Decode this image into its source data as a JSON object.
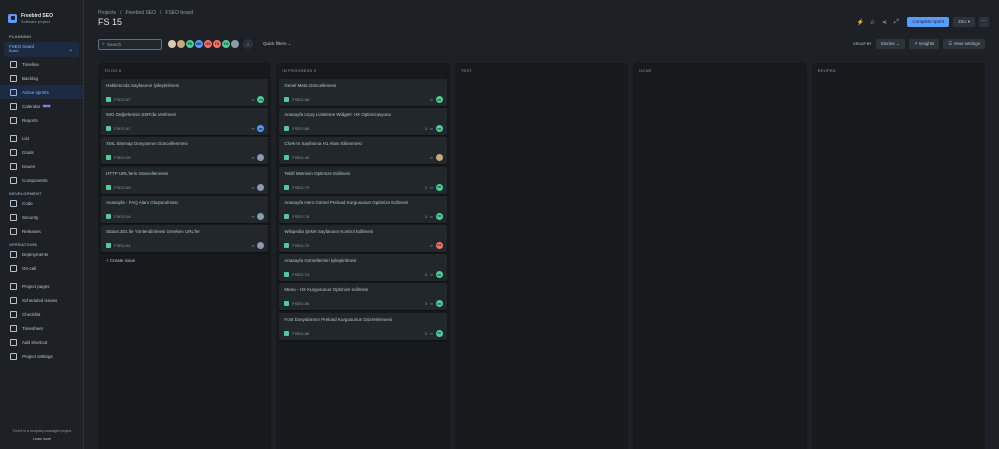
{
  "project": {
    "name": "Freebird SEO",
    "type": "Software project"
  },
  "sidebar": {
    "planning_label": "PLANNING",
    "board_selector": {
      "title": "FSEO board",
      "subtitle": "Board"
    },
    "planning_items": [
      {
        "label": "Timeline",
        "icon": "timeline-icon"
      },
      {
        "label": "Backlog",
        "icon": "backlog-icon"
      },
      {
        "label": "Active sprints",
        "icon": "board-icon",
        "active": true
      },
      {
        "label": "Calendar",
        "icon": "calendar-icon",
        "badge": "NEW"
      },
      {
        "label": "Reports",
        "icon": "reports-icon"
      }
    ],
    "general_items": [
      {
        "label": "List",
        "icon": "list-icon"
      },
      {
        "label": "Goals",
        "icon": "goals-icon"
      },
      {
        "label": "Issues",
        "icon": "issues-icon"
      },
      {
        "label": "Components",
        "icon": "components-icon"
      }
    ],
    "development_label": "DEVELOPMENT",
    "development_items": [
      {
        "label": "Code",
        "icon": "code-icon"
      },
      {
        "label": "Security",
        "icon": "security-icon"
      },
      {
        "label": "Releases",
        "icon": "releases-icon"
      }
    ],
    "operations_label": "OPERATIONS",
    "operations_items": [
      {
        "label": "Deployments",
        "icon": "deployments-icon"
      },
      {
        "label": "On-call",
        "icon": "oncall-icon"
      }
    ],
    "bottom_items": [
      {
        "label": "Project pages",
        "icon": "pages-icon"
      },
      {
        "label": "Scheduled issues",
        "icon": "scheduled-icon"
      },
      {
        "label": "Checklist",
        "icon": "checklist-icon"
      },
      {
        "label": "Timesheet",
        "icon": "timesheet-icon"
      },
      {
        "label": "Add shortcut",
        "icon": "shortcut-icon"
      },
      {
        "label": "Project settings",
        "icon": "settings-icon"
      }
    ],
    "footer_text": "You're in a company-managed project",
    "learn_more": "Learn more"
  },
  "breadcrumbs": [
    "Projects",
    "Freebird SEO",
    "FSEO board"
  ],
  "page_title": "FS 15",
  "header_actions": {
    "complete_sprint": "Complete sprint",
    "jsu": "JSU"
  },
  "toolbar": {
    "search_placeholder": "Search",
    "quick_filters": "Quick filters",
    "group_by_label": "GROUP BY",
    "group_by_value": "Stories",
    "insights": "Insights",
    "view_settings": "View settings"
  },
  "avatars": [
    {
      "initials": "",
      "color": "#d9c9b0"
    },
    {
      "initials": "",
      "color": "#c9a87a"
    },
    {
      "initials": "FK",
      "color": "#4bce97"
    },
    {
      "initials": "MK",
      "color": "#579dff"
    },
    {
      "initials": "OS",
      "color": "#f87168"
    },
    {
      "initials": "TO",
      "color": "#f87168"
    },
    {
      "initials": "YO",
      "color": "#4bce97"
    },
    {
      "initials": "",
      "color": "#8c9bab"
    }
  ],
  "colors": {
    "green": "#4bce97",
    "blue": "#579dff",
    "red": "#f87168",
    "gray": "#8c9bab"
  },
  "columns": [
    {
      "header": "TO DO 6",
      "cards": [
        {
          "title": "Hakkımızda Sayfasının İyileştirilmesi",
          "key": "FSEO-87",
          "est": "",
          "assignee": "YO",
          "assignee_color": "#4bce97"
        },
        {
          "title": "IMG Değerlerinin SSR'da Verilmesi",
          "key": "FSEO-87",
          "est": "",
          "assignee": "MK",
          "assignee_color": "#579dff"
        },
        {
          "title": "XML Sitemap Dosyasının Güncellenmesi",
          "key": "FSEO-90",
          "est": "",
          "assignee": "",
          "assignee_color": "#8c9bab"
        },
        {
          "title": "HTTP URL'lerin Güncellenmesi",
          "key": "FSEO-89",
          "est": "",
          "assignee": "",
          "assignee_color": "#8c9bab"
        },
        {
          "title": "Anasayfa - FAQ Alanı Oluşturulması",
          "key": "FSEO-54",
          "est": "",
          "assignee": "",
          "assignee_color": "#8c9bab"
        },
        {
          "title": "Status:301 İle Yönlendirilmesi Gereken URL'ler",
          "key": "FSEO-81",
          "est": "",
          "assignee": "",
          "assignee_color": "#8c9bab"
        }
      ],
      "create_label": "+ Create issue"
    },
    {
      "header": "IN PROGRESS 9",
      "cards": [
        {
          "title": "Genel Meta Güncellemesi",
          "key": "FSEO-68",
          "est": "",
          "assignee": "FK",
          "assignee_color": "#4bce97"
        },
        {
          "title": "Anasayfa Uçuş Listeleme Widget'ı HX Optimizasyonu",
          "key": "FSEO-85",
          "est": "3",
          "assignee": "FK",
          "assignee_color": "#4bce97"
        },
        {
          "title": "Chek-In Sayfasına H1 Alanı Eklenmesi",
          "key": "FSEO-45",
          "est": "",
          "assignee": "",
          "assignee_color": "#c9a87a"
        },
        {
          "title": "Teklif Metninin Optimize Edilmesi",
          "key": "FSEO-79",
          "est": "3",
          "assignee": "FK",
          "assignee_color": "#4bce97"
        },
        {
          "title": "Anasayfa Hero Görsel Preload Kurgusunun Optimize Edilmesi",
          "key": "FSEO-76",
          "est": "3",
          "assignee": "FK",
          "assignee_color": "#4bce97"
        },
        {
          "title": "Wikipedia Şirket Sayfasının Kontrol Edilmesi",
          "key": "FSEO-70",
          "est": "",
          "assignee": "OS",
          "assignee_color": "#f87168"
        },
        {
          "title": "Anasayfa Görsellerinin İyileştirilmesi",
          "key": "FSEO-74",
          "est": "3",
          "assignee": "FK",
          "assignee_color": "#4bce97"
        },
        {
          "title": "Menu - HX Kurgusunun Optimize edilmesi",
          "key": "FSEO-85",
          "est": "3",
          "assignee": "FK",
          "assignee_color": "#4bce97"
        },
        {
          "title": "Font Dosyalarının Preload Kurgusunun Düzenlenmesi",
          "key": "FSEO-88",
          "est": "3",
          "assignee": "FK",
          "assignee_color": "#4bce97"
        }
      ]
    },
    {
      "header": "TEST",
      "cards": []
    },
    {
      "header": "DONE",
      "cards": []
    },
    {
      "header": "REOPEN",
      "cards": []
    }
  ]
}
